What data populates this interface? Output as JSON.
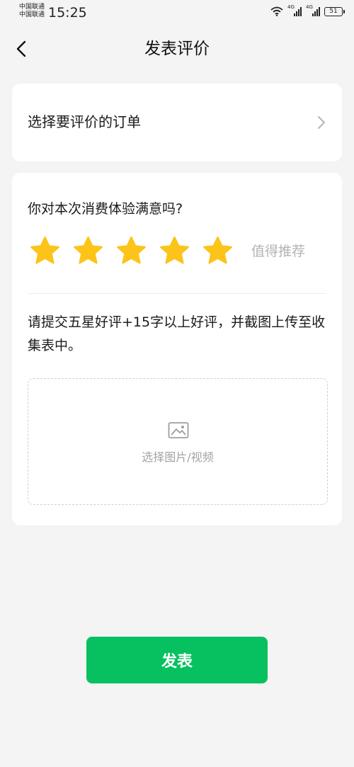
{
  "status_bar": {
    "carrier_1": "中国联通",
    "carrier_2": "中国联通",
    "time": "15:25",
    "network_1": "4G",
    "network_2": "4G",
    "battery": "51"
  },
  "header": {
    "title": "发表评价",
    "back_icon": "chevron-left-icon"
  },
  "order": {
    "label": "选择要评价的订单",
    "chevron_icon": "chevron-right-icon"
  },
  "review": {
    "question": "你对本次消费体验满意吗?",
    "rating": 5,
    "max_rating": 5,
    "rating_text": "值得推荐",
    "instruction": "请提交五星好评+15字以上好评，并截图上传至收集表中。",
    "upload_label": "选择图片/视频",
    "upload_icon": "image-icon"
  },
  "submit_label": "发表",
  "colors": {
    "accent": "#07c160",
    "star": "#fcc419",
    "background": "#f4f4f4"
  }
}
